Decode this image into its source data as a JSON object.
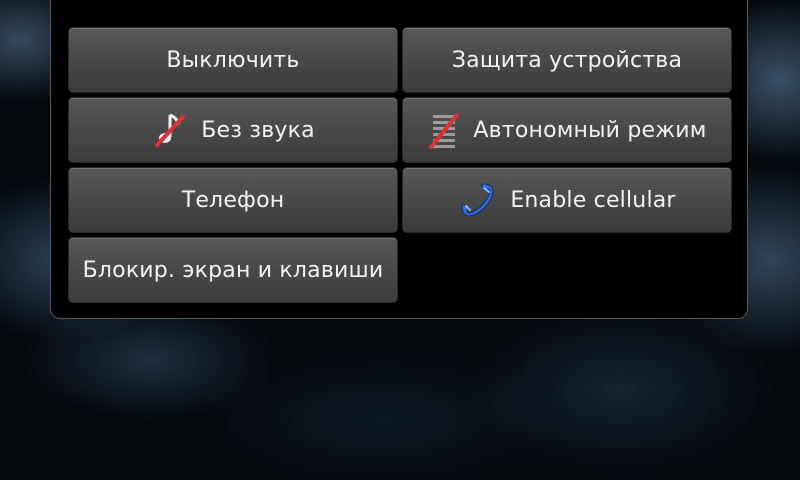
{
  "dialog": {
    "buttons": [
      {
        "label": "Выключить",
        "icon": null
      },
      {
        "label": "Защита устройства",
        "icon": null
      },
      {
        "label": "Без звука",
        "icon": "muted-music-note-icon"
      },
      {
        "label": "Автономный режим",
        "icon": "offline-signal-icon"
      },
      {
        "label": "Телефон",
        "icon": null
      },
      {
        "label": "Enable cellular",
        "icon": "phone-handset-icon"
      },
      {
        "label": "Блокир. экран и клавиши",
        "icon": null
      }
    ]
  },
  "colors": {
    "button_top": "#585858",
    "button_bottom": "#3c3c3c",
    "strike_red": "#e03030",
    "handset_blue": "#2f6fd6"
  }
}
